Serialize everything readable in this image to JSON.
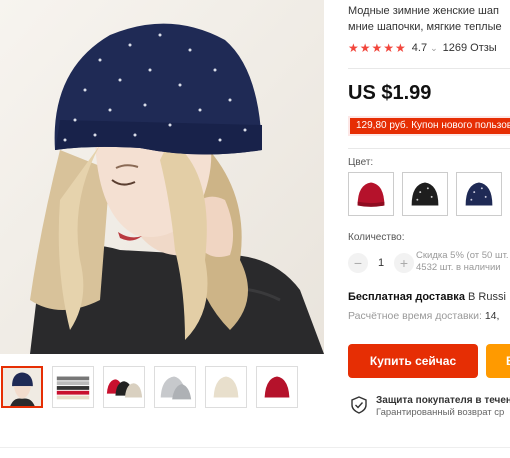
{
  "product": {
    "title_line1": "Модные зимние женские шап",
    "title_line2": "мние шапочки, мягкие теплые",
    "stars": "★★★★★",
    "rating": "4.7",
    "rating_caret": "⌄",
    "reviews": "1269 Отзы",
    "price": "US $1.99",
    "coupon": "129,80 руб. Купон нового пользов"
  },
  "color": {
    "label": "Цвет:",
    "options": [
      "red",
      "black",
      "navy"
    ]
  },
  "quantity": {
    "label": "Количество:",
    "minus": "−",
    "value": "1",
    "plus": "+",
    "discount_note": "Скидка 5% (от 50 шт.",
    "stock_note": "4532 шт. в наличии"
  },
  "shipping": {
    "free": "Бесплатная доставка",
    "destination": " B Russi",
    "time_label": "Расчётное время доставки:",
    "time_value": " 14,"
  },
  "actions": {
    "buy_now": "Купить сейчас",
    "cart_partial": "В"
  },
  "protection": {
    "title": "Защита покупателя в течен",
    "subtitle": "Гарантированный возврат ср"
  },
  "thumbnails": [
    "model-navy",
    "stack-folded",
    "multicolor",
    "grey",
    "beige",
    "red"
  ],
  "colors": {
    "accent": "#e62e04",
    "cart": "#ff9a00",
    "navy_hat": "#1f2a55",
    "coupon_bg": "#fde7e6"
  }
}
